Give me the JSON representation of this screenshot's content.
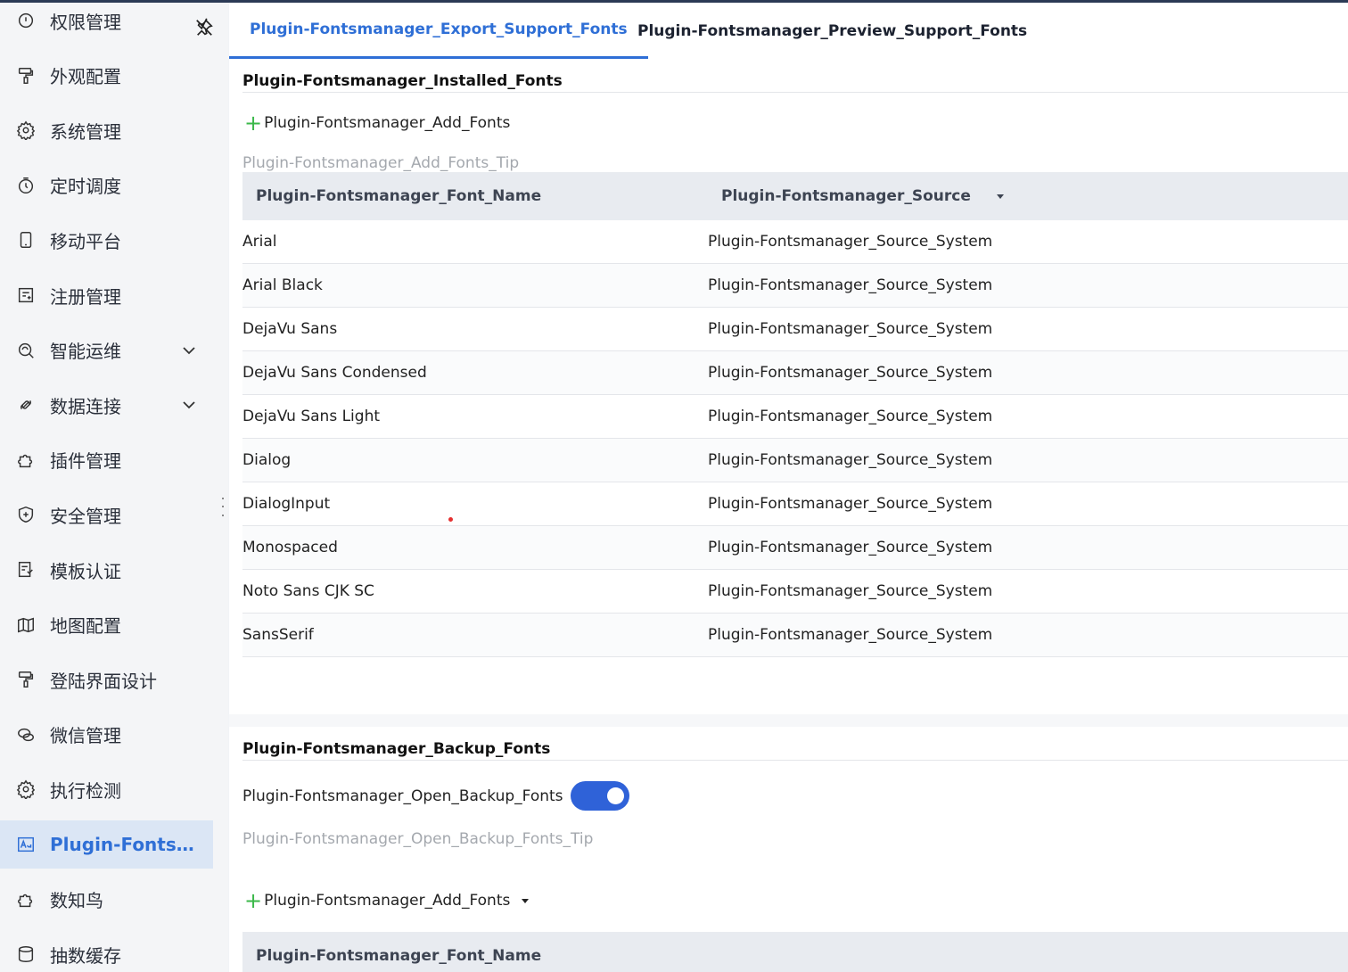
{
  "sidebar": {
    "items": [
      {
        "label": "权限管理",
        "icon": "permission-icon",
        "has_children": false,
        "active": false
      },
      {
        "label": "外观配置",
        "icon": "paint-roller-icon",
        "has_children": false,
        "active": false
      },
      {
        "label": "系统管理",
        "icon": "gear-icon",
        "has_children": false,
        "active": false
      },
      {
        "label": "定时调度",
        "icon": "timer-icon",
        "has_children": false,
        "active": false
      },
      {
        "label": "移动平台",
        "icon": "mobile-icon",
        "has_children": false,
        "active": false
      },
      {
        "label": "注册管理",
        "icon": "register-icon",
        "has_children": false,
        "active": false
      },
      {
        "label": "智能运维",
        "icon": "ops-icon",
        "has_children": true,
        "active": false
      },
      {
        "label": "数据连接",
        "icon": "link-icon",
        "has_children": true,
        "active": false
      },
      {
        "label": "插件管理",
        "icon": "puzzle-icon",
        "has_children": false,
        "active": false
      },
      {
        "label": "安全管理",
        "icon": "shield-icon",
        "has_children": false,
        "active": false
      },
      {
        "label": "模板认证",
        "icon": "template-cert-icon",
        "has_children": false,
        "active": false
      },
      {
        "label": "地图配置",
        "icon": "map-icon",
        "has_children": false,
        "active": false
      },
      {
        "label": "登陆界面设计",
        "icon": "paint-roller-icon",
        "has_children": false,
        "active": false
      },
      {
        "label": "微信管理",
        "icon": "wechat-icon",
        "has_children": false,
        "active": false
      },
      {
        "label": "执行检测",
        "icon": "gear-icon",
        "has_children": false,
        "active": false
      },
      {
        "label": "Plugin-Fontsmanager",
        "icon": "font-icon",
        "has_children": false,
        "active": true
      },
      {
        "label": "数知鸟",
        "icon": "puzzle-icon",
        "has_children": false,
        "active": false
      },
      {
        "label": "抽数缓存",
        "icon": "cache-icon",
        "has_children": false,
        "active": false
      }
    ]
  },
  "tabs": [
    {
      "label": "Plugin-Fontsmanager_Export_Support_Fonts",
      "active": true
    },
    {
      "label": "Plugin-Fontsmanager_Preview_Support_Fonts",
      "active": false
    }
  ],
  "installed": {
    "title": "Plugin-Fontsmanager_Installed_Fonts",
    "add_label": "Plugin-Fontsmanager_Add_Fonts",
    "tip": "Plugin-Fontsmanager_Add_Fonts_Tip",
    "columns": {
      "name": "Plugin-Fontsmanager_Font_Name",
      "source": "Plugin-Fontsmanager_Source"
    },
    "rows": [
      {
        "name": "Arial",
        "source": "Plugin-Fontsmanager_Source_System"
      },
      {
        "name": "Arial Black",
        "source": "Plugin-Fontsmanager_Source_System"
      },
      {
        "name": "DejaVu Sans",
        "source": "Plugin-Fontsmanager_Source_System"
      },
      {
        "name": "DejaVu Sans Condensed",
        "source": "Plugin-Fontsmanager_Source_System"
      },
      {
        "name": "DejaVu Sans Light",
        "source": "Plugin-Fontsmanager_Source_System"
      },
      {
        "name": "Dialog",
        "source": "Plugin-Fontsmanager_Source_System"
      },
      {
        "name": "DialogInput",
        "source": "Plugin-Fontsmanager_Source_System"
      },
      {
        "name": "Monospaced",
        "source": "Plugin-Fontsmanager_Source_System"
      },
      {
        "name": "Noto Sans CJK SC",
        "source": "Plugin-Fontsmanager_Source_System"
      },
      {
        "name": "SansSerif",
        "source": "Plugin-Fontsmanager_Source_System"
      }
    ]
  },
  "backup": {
    "title": "Plugin-Fontsmanager_Backup_Fonts",
    "switch_label": "Plugin-Fontsmanager_Open_Backup_Fonts",
    "switch_on": true,
    "tip": "Plugin-Fontsmanager_Open_Backup_Fonts_Tip",
    "add_label": "Plugin-Fontsmanager_Add_Fonts",
    "columns": {
      "name": "Plugin-Fontsmanager_Font_Name"
    }
  },
  "colors": {
    "accent": "#2f6fd6",
    "switch": "#2f62d8",
    "plus": "#3bb84a",
    "active_bg": "#dbe6f5"
  }
}
